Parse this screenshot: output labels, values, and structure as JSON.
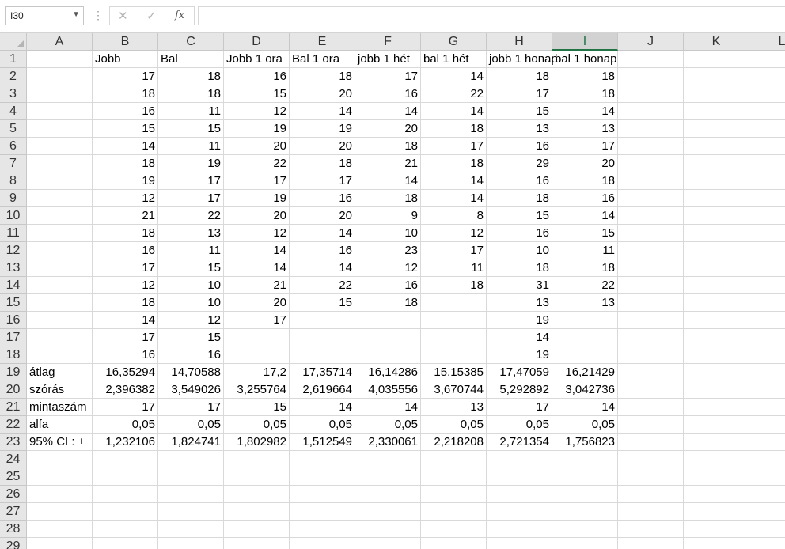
{
  "name_box": "I30",
  "formula_bar": {
    "cancel_icon": "✕",
    "enter_icon": "✓",
    "fx_label": "fx",
    "formula": ""
  },
  "columns": [
    "A",
    "B",
    "C",
    "D",
    "E",
    "F",
    "G",
    "H",
    "I",
    "J",
    "K",
    "L"
  ],
  "selected_column": "I",
  "row_numbers": [
    1,
    2,
    3,
    4,
    5,
    6,
    7,
    8,
    9,
    10,
    11,
    12,
    13,
    14,
    15,
    16,
    17,
    18,
    19,
    20,
    21,
    22,
    23,
    24,
    25,
    26,
    27,
    28,
    29
  ],
  "rows": [
    [
      "",
      "Jobb",
      "Bal",
      "Jobb 1 ora",
      "Bal 1 ora",
      "jobb 1 hét",
      "bal 1 hét",
      "jobb 1 honap",
      "bal 1 honap",
      "",
      "",
      ""
    ],
    [
      "",
      "17",
      "18",
      "16",
      "18",
      "17",
      "14",
      "18",
      "18",
      "",
      "",
      ""
    ],
    [
      "",
      "18",
      "18",
      "15",
      "20",
      "16",
      "22",
      "17",
      "18",
      "",
      "",
      ""
    ],
    [
      "",
      "16",
      "11",
      "12",
      "14",
      "14",
      "14",
      "15",
      "14",
      "",
      "",
      ""
    ],
    [
      "",
      "15",
      "15",
      "19",
      "19",
      "20",
      "18",
      "13",
      "13",
      "",
      "",
      ""
    ],
    [
      "",
      "14",
      "11",
      "20",
      "20",
      "18",
      "17",
      "16",
      "17",
      "",
      "",
      ""
    ],
    [
      "",
      "18",
      "19",
      "22",
      "18",
      "21",
      "18",
      "29",
      "20",
      "",
      "",
      ""
    ],
    [
      "",
      "19",
      "17",
      "17",
      "17",
      "14",
      "14",
      "16",
      "18",
      "",
      "",
      ""
    ],
    [
      "",
      "12",
      "17",
      "19",
      "16",
      "18",
      "14",
      "18",
      "16",
      "",
      "",
      ""
    ],
    [
      "",
      "21",
      "22",
      "20",
      "20",
      "9",
      "8",
      "15",
      "14",
      "",
      "",
      ""
    ],
    [
      "",
      "18",
      "13",
      "12",
      "14",
      "10",
      "12",
      "16",
      "15",
      "",
      "",
      ""
    ],
    [
      "",
      "16",
      "11",
      "14",
      "16",
      "23",
      "17",
      "10",
      "11",
      "",
      "",
      ""
    ],
    [
      "",
      "17",
      "15",
      "14",
      "14",
      "12",
      "11",
      "18",
      "18",
      "",
      "",
      ""
    ],
    [
      "",
      "12",
      "10",
      "21",
      "22",
      "16",
      "18",
      "31",
      "22",
      "",
      "",
      ""
    ],
    [
      "",
      "18",
      "10",
      "20",
      "15",
      "18",
      "",
      "13",
      "13",
      "",
      "",
      ""
    ],
    [
      "",
      "14",
      "12",
      "17",
      "",
      "",
      "",
      "19",
      "",
      "",
      "",
      ""
    ],
    [
      "",
      "17",
      "15",
      "",
      "",
      "",
      "",
      "14",
      "",
      "",
      "",
      ""
    ],
    [
      "",
      "16",
      "16",
      "",
      "",
      "",
      "",
      "19",
      "",
      "",
      "",
      ""
    ],
    [
      "átlag",
      "16,35294",
      "14,70588",
      "17,2",
      "17,35714",
      "16,14286",
      "15,15385",
      "17,47059",
      "16,21429",
      "",
      "",
      ""
    ],
    [
      "szórás",
      "2,396382",
      "3,549026",
      "3,255764",
      "2,619664",
      "4,035556",
      "3,670744",
      "5,292892",
      "3,042736",
      "",
      "",
      ""
    ],
    [
      "mintaszám",
      "17",
      "17",
      "15",
      "14",
      "14",
      "13",
      "17",
      "14",
      "",
      "",
      ""
    ],
    [
      "alfa",
      "0,05",
      "0,05",
      "0,05",
      "0,05",
      "0,05",
      "0,05",
      "0,05",
      "0,05",
      "",
      "",
      ""
    ],
    [
      "95% CI : ±",
      "1,232106",
      "1,824741",
      "1,802982",
      "1,512549",
      "2,330061",
      "2,218208",
      "2,721354",
      "1,756823",
      "",
      "",
      ""
    ],
    [
      "",
      "",
      "",
      "",
      "",
      "",
      "",
      "",
      "",
      "",
      "",
      ""
    ],
    [
      "",
      "",
      "",
      "",
      "",
      "",
      "",
      "",
      "",
      "",
      "",
      ""
    ],
    [
      "",
      "",
      "",
      "",
      "",
      "",
      "",
      "",
      "",
      "",
      "",
      ""
    ],
    [
      "",
      "",
      "",
      "",
      "",
      "",
      "",
      "",
      "",
      "",
      "",
      ""
    ],
    [
      "",
      "",
      "",
      "",
      "",
      "",
      "",
      "",
      "",
      "",
      "",
      ""
    ],
    [
      "",
      "",
      "",
      "",
      "",
      "",
      "",
      "",
      "",
      "",
      "",
      ""
    ]
  ]
}
